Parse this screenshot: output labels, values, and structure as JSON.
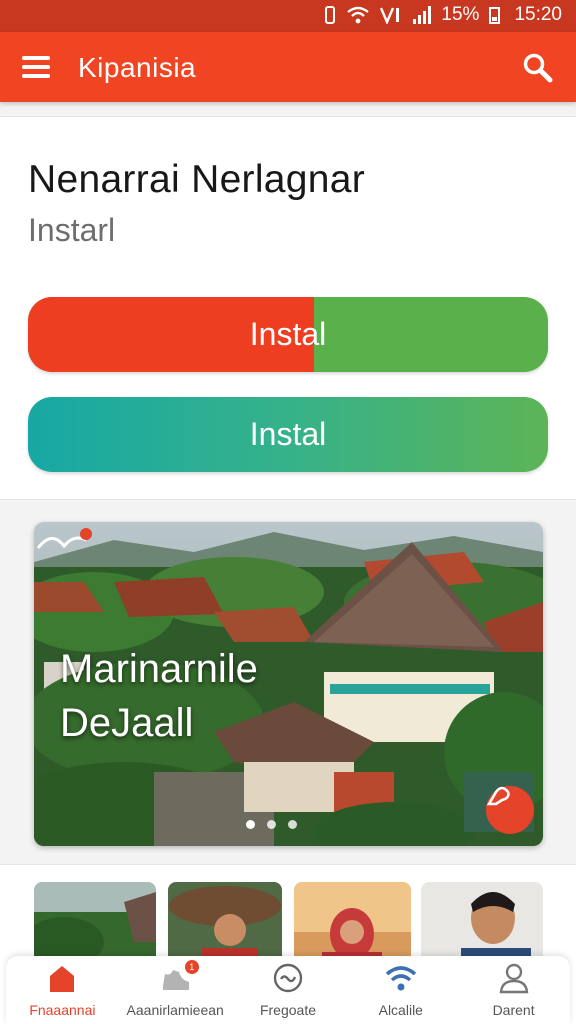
{
  "status_bar": {
    "battery": "15%",
    "time": "15:20"
  },
  "app_bar": {
    "title": "Kipanisia"
  },
  "header": {
    "title": "Nenarrai Nerlagnar",
    "subtitle": "Instarl"
  },
  "progress_button": {
    "label": "Instal",
    "progress_percent": 55
  },
  "install_button": {
    "label": "Instal"
  },
  "banner": {
    "line1": "Marinarnile",
    "line2": "DeJaall",
    "slide_count": 3,
    "active_slide": 1
  },
  "thumbnails": [
    "village-thumb",
    "hat-person-thumb",
    "hijab-woman-thumb",
    "man-portrait-thumb"
  ],
  "bottom_nav": {
    "items": [
      {
        "label": "Fnaaannai",
        "icon": "home-icon",
        "active": true
      },
      {
        "label": "Aaanirlamieean",
        "icon": "shoe-icon",
        "badge": "1"
      },
      {
        "label": "Fregoate",
        "icon": "chat-icon"
      },
      {
        "label": "Alcalile",
        "icon": "wifi-icon"
      },
      {
        "label": "Darent",
        "icon": "person-icon"
      }
    ]
  },
  "colors": {
    "primary": "#f04423",
    "status": "#c8371f",
    "green": "#5ab04a",
    "teal": "#17a8a5"
  }
}
